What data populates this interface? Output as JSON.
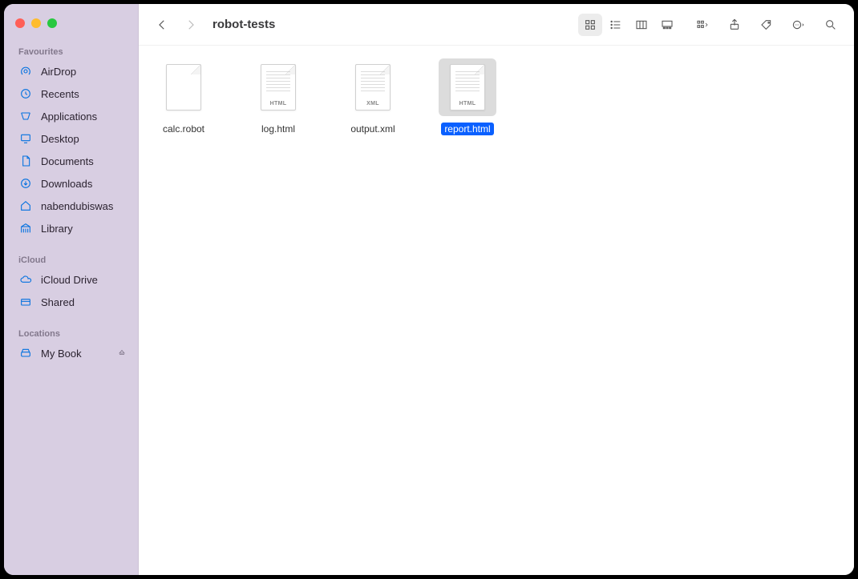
{
  "window": {
    "title": "robot-tests"
  },
  "sidebar": {
    "sections": [
      {
        "header": "Favourites",
        "items": [
          {
            "label": "AirDrop",
            "icon": "airdrop"
          },
          {
            "label": "Recents",
            "icon": "clock"
          },
          {
            "label": "Applications",
            "icon": "apps"
          },
          {
            "label": "Desktop",
            "icon": "desktop"
          },
          {
            "label": "Documents",
            "icon": "doc"
          },
          {
            "label": "Downloads",
            "icon": "download"
          },
          {
            "label": "nabendubiswas",
            "icon": "home"
          },
          {
            "label": "Library",
            "icon": "library"
          }
        ]
      },
      {
        "header": "iCloud",
        "items": [
          {
            "label": "iCloud Drive",
            "icon": "cloud"
          },
          {
            "label": "Shared",
            "icon": "shared"
          }
        ]
      },
      {
        "header": "Locations",
        "items": [
          {
            "label": "My Book",
            "icon": "disk",
            "ejectable": true
          }
        ]
      }
    ]
  },
  "files": [
    {
      "name": "calc.robot",
      "type": "",
      "selected": false
    },
    {
      "name": "log.html",
      "type": "HTML",
      "selected": false
    },
    {
      "name": "output.xml",
      "type": "XML",
      "selected": false
    },
    {
      "name": "report.html",
      "type": "HTML",
      "selected": true
    }
  ]
}
